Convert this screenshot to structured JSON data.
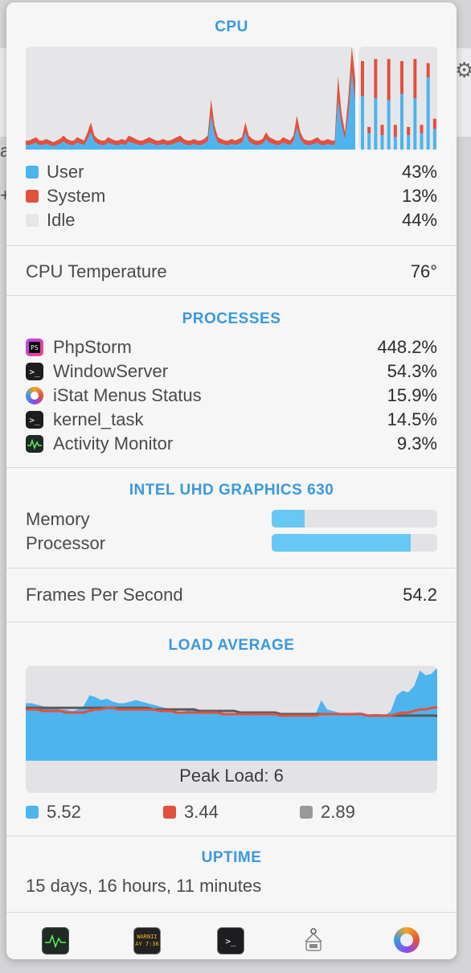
{
  "background": {
    "frag_a": "a",
    "frag_b": "+"
  },
  "cpu": {
    "title": "CPU",
    "legend": [
      {
        "label": "User",
        "value": "43%",
        "color": "#4eb4ee"
      },
      {
        "label": "System",
        "value": "13%",
        "color": "#e2503e"
      },
      {
        "label": "Idle",
        "value": "44%",
        "color": "#e6e6e8"
      }
    ],
    "temperature_label": "CPU Temperature",
    "temperature_value": "76°",
    "history_system_pct": [
      3,
      3,
      4,
      5,
      3,
      3,
      4,
      3,
      2,
      3,
      4,
      6,
      4,
      3,
      3,
      5,
      4,
      3,
      8,
      14,
      6,
      4,
      3,
      3,
      5,
      4,
      3,
      3,
      4,
      3,
      6,
      5,
      4,
      3,
      3,
      4,
      5,
      4,
      3,
      3,
      4,
      3,
      3,
      4,
      5,
      6,
      4,
      3,
      3,
      4,
      3,
      3,
      4,
      6,
      28,
      12,
      5,
      4,
      3,
      3,
      4,
      3,
      4,
      5,
      14,
      6,
      4,
      3,
      3,
      4,
      8,
      5,
      4,
      3,
      3,
      5,
      4,
      3,
      6,
      18,
      8,
      4,
      3,
      3,
      4,
      5,
      3,
      3,
      4,
      3,
      3,
      42,
      20,
      8,
      30,
      66,
      40
    ],
    "core_bars": [
      {
        "total": 86,
        "user": 52
      },
      {
        "total": 22,
        "user": 16
      },
      {
        "total": 88,
        "user": 50
      },
      {
        "total": 24,
        "user": 14
      },
      {
        "total": 88,
        "user": 48
      },
      {
        "total": 24,
        "user": 12
      },
      {
        "total": 86,
        "user": 54
      },
      {
        "total": 22,
        "user": 14
      },
      {
        "total": 88,
        "user": 50
      },
      {
        "total": 24,
        "user": 16
      },
      {
        "total": 84,
        "user": 70
      },
      {
        "total": 30,
        "user": 20
      }
    ]
  },
  "processes": {
    "title": "PROCESSES",
    "items": [
      {
        "name": "PhpStorm",
        "value": "448.2%",
        "icon": "phpstorm-icon"
      },
      {
        "name": "WindowServer",
        "value": "54.3%",
        "icon": "terminal-icon"
      },
      {
        "name": "iStat Menus Status",
        "value": "15.9%",
        "icon": "istat-icon"
      },
      {
        "name": "kernel_task",
        "value": "14.5%",
        "icon": "terminal-icon"
      },
      {
        "name": "Activity Monitor",
        "value": "9.3%",
        "icon": "activity-monitor-icon"
      }
    ]
  },
  "gpu": {
    "title": "INTEL UHD GRAPHICS 630",
    "memory_label": "Memory",
    "memory_fraction": 0.2,
    "processor_label": "Processor",
    "processor_fraction": 0.84
  },
  "fps": {
    "label": "Frames Per Second",
    "value": "54.2"
  },
  "load": {
    "title": "LOAD AVERAGE",
    "peak_label": "Peak Load: 6",
    "legend": [
      {
        "value": "5.52",
        "color": "#4eb4ee"
      },
      {
        "value": "3.44",
        "color": "#e2503e"
      },
      {
        "value": "2.89",
        "color": "#999999"
      }
    ],
    "history": {
      "one": [
        3.7,
        3.7,
        3.6,
        3.5,
        3.4,
        3.4,
        3.3,
        3.3,
        3.2,
        3.3,
        3.5,
        4.2,
        4.1,
        3.9,
        4.0,
        3.8,
        3.7,
        3.7,
        3.8,
        3.9,
        3.8,
        3.7,
        3.6,
        3.5,
        3.4,
        3.3,
        3.2,
        3.1,
        3.3,
        3.4,
        3.2,
        3.1,
        3.2,
        3.2,
        3.1,
        3.0,
        3.0,
        2.9,
        3.1,
        3.1,
        3.0,
        2.9,
        3.0,
        3.0,
        2.9,
        3.0,
        2.9,
        3.0,
        3.0,
        2.9,
        3.0,
        3.9,
        3.3,
        3.2,
        3.1,
        3.0,
        3.0,
        3.1,
        3.1,
        2.9,
        3.0,
        3.0,
        2.9,
        3.2,
        4.2,
        4.5,
        4.4,
        4.8,
        5.8,
        5.5,
        5.6,
        6.0
      ],
      "five": [
        3.3,
        3.3,
        3.3,
        3.2,
        3.2,
        3.2,
        3.2,
        3.1,
        3.1,
        3.1,
        3.1,
        3.2,
        3.3,
        3.3,
        3.4,
        3.4,
        3.3,
        3.3,
        3.3,
        3.3,
        3.3,
        3.3,
        3.3,
        3.2,
        3.2,
        3.2,
        3.1,
        3.1,
        3.1,
        3.1,
        3.1,
        3.1,
        3.1,
        3.1,
        3.0,
        3.0,
        3.0,
        3.0,
        3.0,
        3.0,
        3.0,
        3.0,
        3.0,
        3.0,
        2.9,
        2.9,
        2.9,
        2.9,
        2.9,
        2.9,
        2.9,
        3.0,
        3.0,
        3.0,
        3.0,
        3.0,
        3.0,
        3.0,
        3.0,
        2.9,
        2.9,
        2.9,
        2.9,
        2.9,
        3.0,
        3.1,
        3.1,
        3.2,
        3.3,
        3.3,
        3.4,
        3.44
      ],
      "fifteen": [
        3.4,
        3.4,
        3.4,
        3.4,
        3.4,
        3.4,
        3.4,
        3.4,
        3.4,
        3.4,
        3.4,
        3.4,
        3.4,
        3.4,
        3.4,
        3.4,
        3.4,
        3.4,
        3.4,
        3.4,
        3.4,
        3.4,
        3.3,
        3.3,
        3.3,
        3.3,
        3.3,
        3.3,
        3.3,
        3.3,
        3.2,
        3.2,
        3.2,
        3.2,
        3.2,
        3.2,
        3.2,
        3.1,
        3.1,
        3.1,
        3.1,
        3.1,
        3.1,
        3.1,
        3.0,
        3.0,
        3.0,
        3.0,
        3.0,
        3.0,
        3.0,
        3.0,
        3.0,
        3.0,
        3.0,
        3.0,
        3.0,
        3.0,
        3.0,
        2.9,
        2.9,
        2.9,
        2.9,
        2.9,
        2.9,
        2.9,
        2.9,
        2.9,
        2.9,
        2.9,
        2.9,
        2.89
      ],
      "max": 6
    }
  },
  "uptime": {
    "title": "UPTIME",
    "value": "15 days, 16 hours, 11 minutes"
  },
  "dock": {
    "console_text_1": "WARNII",
    "console_text_2": "AY 7:36",
    "terminal_text": ">_"
  }
}
